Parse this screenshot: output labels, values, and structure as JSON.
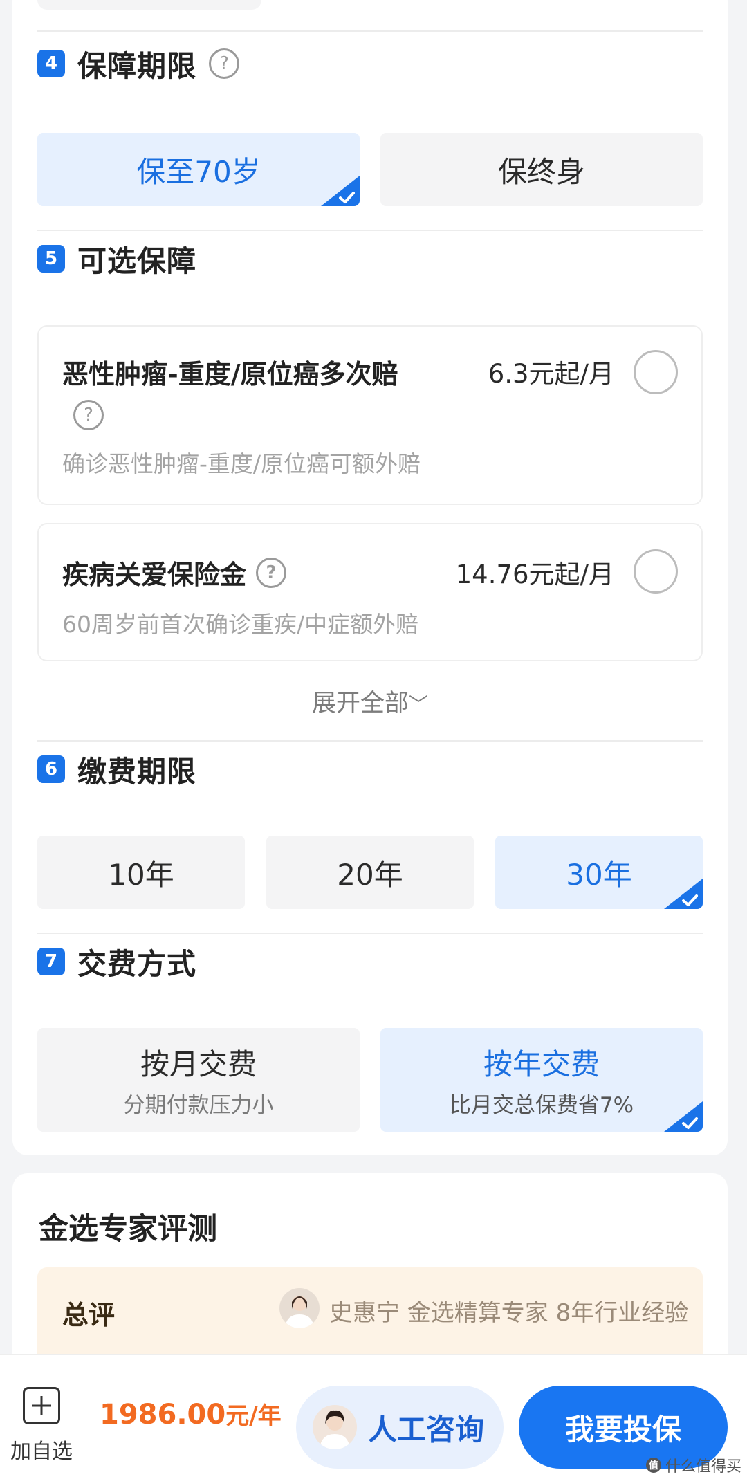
{
  "sections": {
    "term": {
      "number": "4",
      "title": "保障期限",
      "help_icon": "?",
      "options": [
        {
          "label": "保至70岁"
        },
        {
          "label": "保终身"
        }
      ],
      "selected": "保至70岁"
    },
    "optional": {
      "number": "5",
      "title": "可选保障",
      "items": [
        {
          "name": "恶性肿瘤-重度/原位癌多次赔",
          "price": "6.3元起/月",
          "help_icon": "?",
          "desc": "确诊恶性肿瘤-重度/原位癌可额外赔"
        },
        {
          "name": "疾病关爱保险金",
          "price": "14.76元起/月",
          "help_icon": "?",
          "desc": "60周岁前首次确诊重疾/中症额外赔"
        }
      ],
      "expand_label": "展开全部",
      "expand_icon": "﹀"
    },
    "pay_term": {
      "number": "6",
      "title": "缴费期限",
      "options": [
        {
          "label": "10年"
        },
        {
          "label": "20年"
        },
        {
          "label": "30年"
        }
      ],
      "selected": "30年"
    },
    "pay_mode": {
      "number": "7",
      "title": "交费方式",
      "options": [
        {
          "label": "按月交费",
          "sub": "分期付款压力小"
        },
        {
          "label": "按年交费",
          "sub": "比月交总保费省7%"
        }
      ],
      "selected": "按年交费"
    }
  },
  "review": {
    "title": "金选专家评测",
    "label": "总评",
    "expert": "史惠宁  金选精算专家  8年行业经验"
  },
  "bottom_bar": {
    "add_fav": "加自选",
    "price_amount": "1986.00",
    "price_unit": "元/年",
    "consult_label": "人工咨询",
    "buy_label": "我要投保"
  },
  "watermark": {
    "icon": "值",
    "text": "什么值得买"
  },
  "colors": {
    "accent": "#1a73e8",
    "price": "#f26a21",
    "selected_bg": "#e6f0fe",
    "review_bg": "#fdf3e6"
  }
}
